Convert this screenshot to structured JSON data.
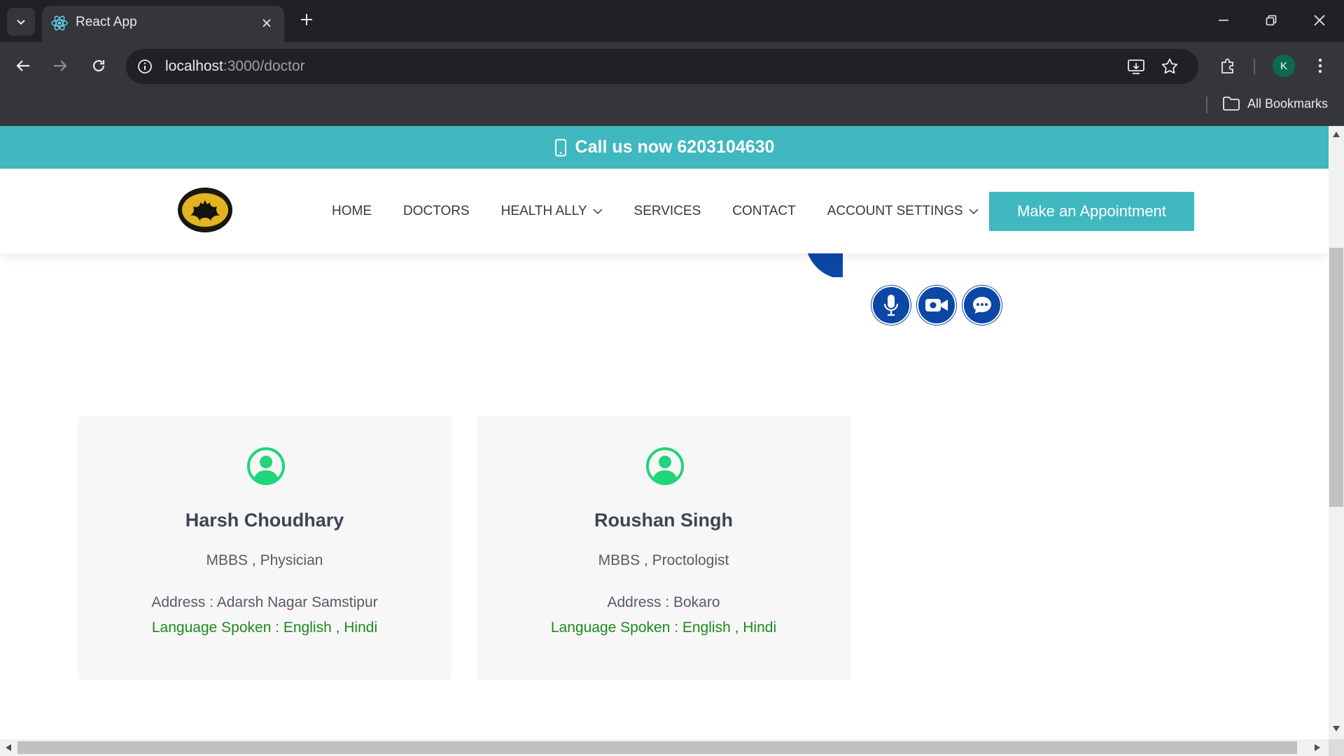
{
  "browser": {
    "tab_title": "React App",
    "url_host": "localhost",
    "url_rest": ":3000/doctor",
    "bookmarks_label": "All Bookmarks",
    "profile_initial": "K"
  },
  "topbar": {
    "text": "Call us now 6203104630",
    "icon": "mobile-phone-icon"
  },
  "header": {
    "nav": [
      {
        "label": "HOME",
        "dropdown": false
      },
      {
        "label": "DOCTORS",
        "dropdown": false
      },
      {
        "label": "HEALTH ALLY",
        "dropdown": true
      },
      {
        "label": "SERVICES",
        "dropdown": false
      },
      {
        "label": "CONTACT",
        "dropdown": false
      },
      {
        "label": "ACCOUNT SETTINGS",
        "dropdown": true
      }
    ],
    "cta_label": "Make an Appointment"
  },
  "hero": {
    "call_icons": [
      "microphone-icon",
      "video-camera-icon",
      "chat-bubble-icon"
    ]
  },
  "doctors": [
    {
      "name": "Harsh Choudhary",
      "degree": "MBBS , Physician",
      "address": "Address : Adarsh Nagar Samstipur",
      "languages": "Language Spoken : English , Hindi"
    },
    {
      "name": "Roushan Singh",
      "degree": "MBBS , Proctologist",
      "address": "Address : Bokaro",
      "languages": "Language Spoken : English , Hindi"
    }
  ],
  "colors": {
    "accent": "#3fb8c0",
    "language_text": "#1b8a1b",
    "icon_green": "#22d47a",
    "hero_blue": "#0c47a6"
  }
}
